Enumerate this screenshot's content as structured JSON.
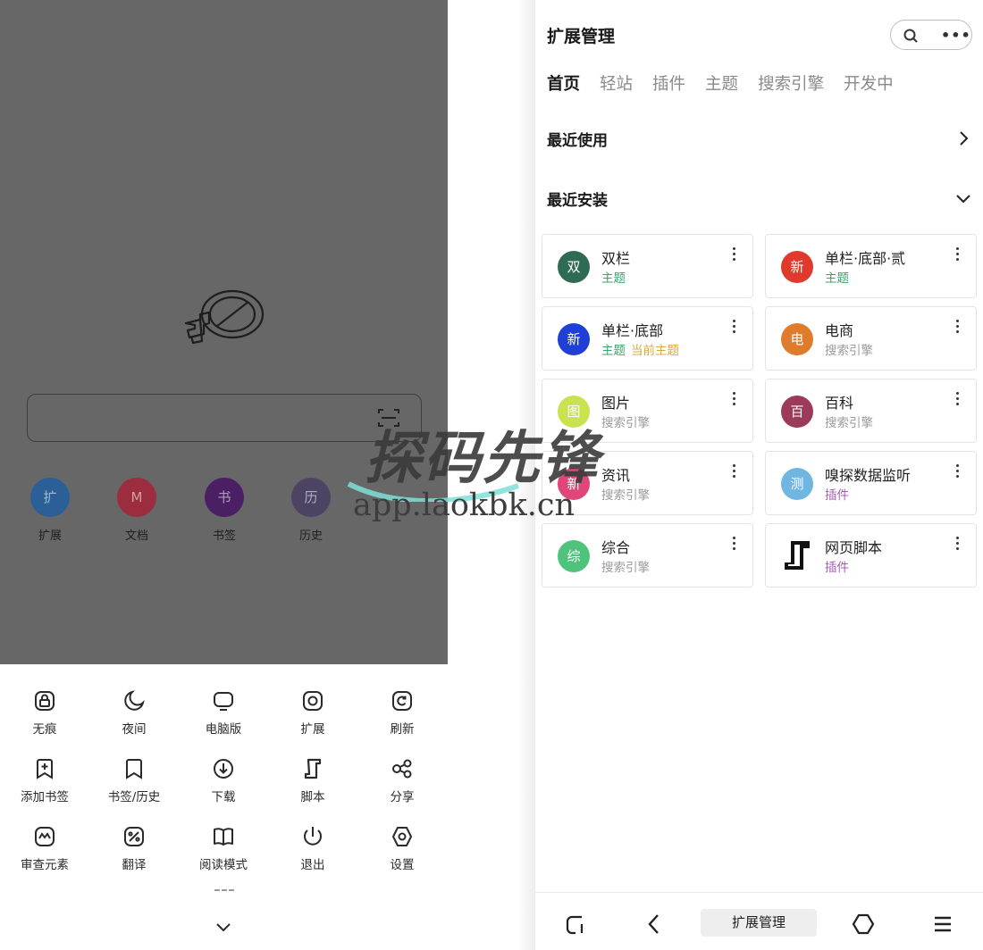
{
  "left": {
    "shortcuts": [
      {
        "label": "扩展",
        "glyph": "扩",
        "color": "#2b5f97"
      },
      {
        "label": "文档",
        "glyph": "M",
        "color": "#9b2d3e"
      },
      {
        "label": "书签",
        "glyph": "书",
        "color": "#4b1f63"
      },
      {
        "label": "历史",
        "glyph": "历",
        "color": "#4d4463"
      }
    ],
    "menu": [
      {
        "label": "无痕",
        "icon": "lock-icon"
      },
      {
        "label": "夜间",
        "icon": "moon-icon"
      },
      {
        "label": "电脑版",
        "icon": "monitor-icon"
      },
      {
        "label": "扩展",
        "icon": "extension-icon"
      },
      {
        "label": "刷新",
        "icon": "refresh-icon"
      },
      {
        "label": "添加书签",
        "icon": "add-bookmark-icon"
      },
      {
        "label": "书签/历史",
        "icon": "bookmark-icon"
      },
      {
        "label": "下载",
        "icon": "download-icon"
      },
      {
        "label": "脚本",
        "icon": "script-icon"
      },
      {
        "label": "分享",
        "icon": "share-icon"
      },
      {
        "label": "审查元素",
        "icon": "inspect-icon"
      },
      {
        "label": "翻译",
        "icon": "translate-icon"
      },
      {
        "label": "阅读模式",
        "icon": "book-icon"
      },
      {
        "label": "退出",
        "icon": "power-icon"
      },
      {
        "label": "设置",
        "icon": "settings-icon"
      }
    ]
  },
  "right": {
    "title": "扩展管理",
    "more": "•••",
    "tabs": [
      "首页",
      "轻站",
      "插件",
      "主题",
      "搜索引擎",
      "开发中"
    ],
    "recent_used": "最近使用",
    "recent_installed": "最近安装",
    "cards": [
      {
        "name": "双栏",
        "glyph": "双",
        "color": "#2f6b52",
        "tags": [
          {
            "text": "主题",
            "color": "#3aa36a"
          }
        ]
      },
      {
        "name": "单栏·底部·贰",
        "glyph": "新",
        "color": "#e03a2c",
        "tags": [
          {
            "text": "主题",
            "color": "#3aa36a"
          }
        ]
      },
      {
        "name": "单栏·底部",
        "glyph": "新",
        "color": "#1f3fd6",
        "tags": [
          {
            "text": "主题",
            "color": "#3aa36a"
          },
          {
            "text": "当前主题",
            "color": "#d9a93a"
          }
        ]
      },
      {
        "name": "电商",
        "glyph": "电",
        "color": "#e07b2c",
        "tags": [
          {
            "text": "搜索引擎",
            "color": "#9a9a9a"
          }
        ]
      },
      {
        "name": "图片",
        "glyph": "图",
        "color": "#c9e24f",
        "tags": [
          {
            "text": "搜索引擎",
            "color": "#9a9a9a"
          }
        ]
      },
      {
        "name": "百科",
        "glyph": "百",
        "color": "#9b3a59",
        "tags": [
          {
            "text": "搜索引擎",
            "color": "#9a9a9a"
          }
        ]
      },
      {
        "name": "资讯",
        "glyph": "新",
        "color": "#e0467a",
        "tags": [
          {
            "text": "搜索引擎",
            "color": "#9a9a9a"
          }
        ]
      },
      {
        "name": "嗅探数据监听",
        "glyph": "测",
        "color": "#6fb6e0",
        "tags": [
          {
            "text": "插件",
            "color": "#a55bb8"
          }
        ]
      },
      {
        "name": "综合",
        "glyph": "综",
        "color": "#4fc27c",
        "tags": [
          {
            "text": "搜索引擎",
            "color": "#9a9a9a"
          }
        ]
      },
      {
        "name": "网页脚本",
        "glyph": "",
        "color": "",
        "tags": [
          {
            "text": "插件",
            "color": "#a55bb8"
          }
        ]
      }
    ],
    "navbar_title": "扩展管理"
  },
  "watermark": {
    "main": "探码先锋",
    "url": "app.laokbk.cn"
  }
}
